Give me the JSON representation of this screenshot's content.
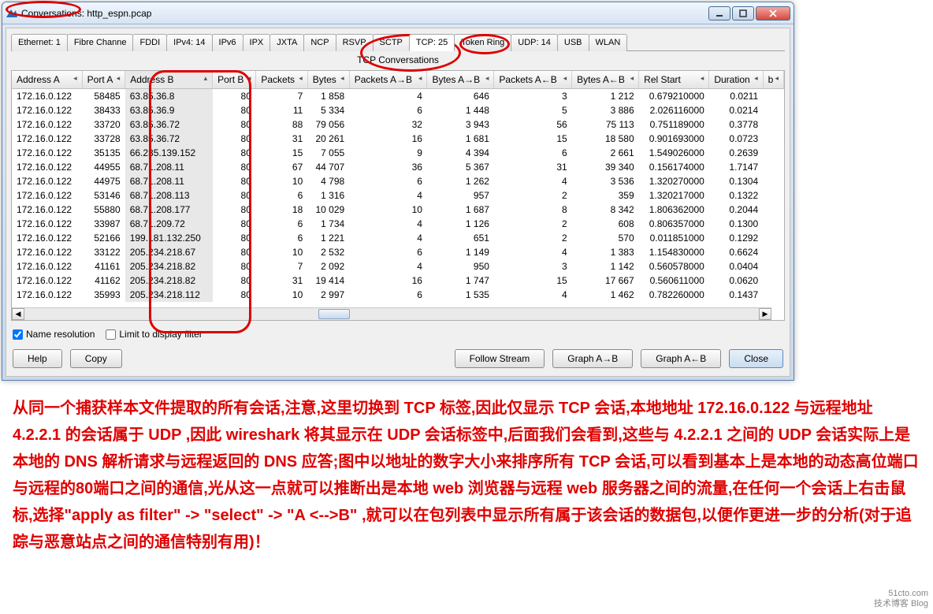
{
  "window": {
    "title": "Conversations: http_espn.pcap",
    "min_icon": "min-icon",
    "max_icon": "max-icon",
    "close_icon": "close-icon"
  },
  "tabs": [
    {
      "label": "Ethernet: 1"
    },
    {
      "label": "Fibre Channe"
    },
    {
      "label": "FDDI"
    },
    {
      "label": "IPv4: 14"
    },
    {
      "label": "IPv6"
    },
    {
      "label": "IPX"
    },
    {
      "label": "JXTA"
    },
    {
      "label": "NCP"
    },
    {
      "label": "RSVP"
    },
    {
      "label": "SCTP"
    },
    {
      "label": "TCP: 25",
      "active": true
    },
    {
      "label": "Token Ring"
    },
    {
      "label": "UDP: 14"
    },
    {
      "label": "USB"
    },
    {
      "label": "WLAN"
    }
  ],
  "subtitle": "TCP Conversations",
  "columns": [
    "Address A",
    "Port A",
    "Address B",
    "Port B",
    "Packets",
    "Bytes",
    "Packets A→B",
    "Bytes A→B",
    "Packets A←B",
    "Bytes A←B",
    "Rel Start",
    "Duration",
    "b"
  ],
  "rows": [
    {
      "aa": "172.16.0.122",
      "pa": "58485",
      "ab": "63.85.36.8",
      "pb": "80",
      "pk": "7",
      "by": "1 858",
      "pab": "4",
      "bab": "646",
      "pba": "3",
      "bba": "1 212",
      "rs": "0.679210000",
      "du": "0.0211"
    },
    {
      "aa": "172.16.0.122",
      "pa": "38433",
      "ab": "63.85.36.9",
      "pb": "80",
      "pk": "11",
      "by": "5 334",
      "pab": "6",
      "bab": "1 448",
      "pba": "5",
      "bba": "3 886",
      "rs": "2.026116000",
      "du": "0.0214"
    },
    {
      "aa": "172.16.0.122",
      "pa": "33720",
      "ab": "63.85.36.72",
      "pb": "80",
      "pk": "88",
      "by": "79 056",
      "pab": "32",
      "bab": "3 943",
      "pba": "56",
      "bba": "75 113",
      "rs": "0.751189000",
      "du": "0.3778"
    },
    {
      "aa": "172.16.0.122",
      "pa": "33728",
      "ab": "63.85.36.72",
      "pb": "80",
      "pk": "31",
      "by": "20 261",
      "pab": "16",
      "bab": "1 681",
      "pba": "15",
      "bba": "18 580",
      "rs": "0.901693000",
      "du": "0.0723"
    },
    {
      "aa": "172.16.0.122",
      "pa": "35135",
      "ab": "66.235.139.152",
      "pb": "80",
      "pk": "15",
      "by": "7 055",
      "pab": "9",
      "bab": "4 394",
      "pba": "6",
      "bba": "2 661",
      "rs": "1.549026000",
      "du": "0.2639"
    },
    {
      "aa": "172.16.0.122",
      "pa": "44955",
      "ab": "68.71.208.11",
      "pb": "80",
      "pk": "67",
      "by": "44 707",
      "pab": "36",
      "bab": "5 367",
      "pba": "31",
      "bba": "39 340",
      "rs": "0.156174000",
      "du": "1.7147"
    },
    {
      "aa": "172.16.0.122",
      "pa": "44975",
      "ab": "68.71.208.11",
      "pb": "80",
      "pk": "10",
      "by": "4 798",
      "pab": "6",
      "bab": "1 262",
      "pba": "4",
      "bba": "3 536",
      "rs": "1.320270000",
      "du": "0.1304"
    },
    {
      "aa": "172.16.0.122",
      "pa": "53146",
      "ab": "68.71.208.113",
      "pb": "80",
      "pk": "6",
      "by": "1 316",
      "pab": "4",
      "bab": "957",
      "pba": "2",
      "bba": "359",
      "rs": "1.320217000",
      "du": "0.1322"
    },
    {
      "aa": "172.16.0.122",
      "pa": "55880",
      "ab": "68.71.208.177",
      "pb": "80",
      "pk": "18",
      "by": "10 029",
      "pab": "10",
      "bab": "1 687",
      "pba": "8",
      "bba": "8 342",
      "rs": "1.806362000",
      "du": "0.2044"
    },
    {
      "aa": "172.16.0.122",
      "pa": "33987",
      "ab": "68.71.209.72",
      "pb": "80",
      "pk": "6",
      "by": "1 734",
      "pab": "4",
      "bab": "1 126",
      "pba": "2",
      "bba": "608",
      "rs": "0.806357000",
      "du": "0.1300"
    },
    {
      "aa": "172.16.0.122",
      "pa": "52166",
      "ab": "199.181.132.250",
      "pb": "80",
      "pk": "6",
      "by": "1 221",
      "pab": "4",
      "bab": "651",
      "pba": "2",
      "bba": "570",
      "rs": "0.011851000",
      "du": "0.1292"
    },
    {
      "aa": "172.16.0.122",
      "pa": "33122",
      "ab": "205.234.218.67",
      "pb": "80",
      "pk": "10",
      "by": "2 532",
      "pab": "6",
      "bab": "1 149",
      "pba": "4",
      "bba": "1 383",
      "rs": "1.154830000",
      "du": "0.6624"
    },
    {
      "aa": "172.16.0.122",
      "pa": "41161",
      "ab": "205.234.218.82",
      "pb": "80",
      "pk": "7",
      "by": "2 092",
      "pab": "4",
      "bab": "950",
      "pba": "3",
      "bba": "1 142",
      "rs": "0.560578000",
      "du": "0.0404"
    },
    {
      "aa": "172.16.0.122",
      "pa": "41162",
      "ab": "205.234.218.82",
      "pb": "80",
      "pk": "31",
      "by": "19 414",
      "pab": "16",
      "bab": "1 747",
      "pba": "15",
      "bba": "17 667",
      "rs": "0.560611000",
      "du": "0.0620"
    },
    {
      "aa": "172.16.0.122",
      "pa": "35993",
      "ab": "205.234.218.112",
      "pb": "80",
      "pk": "10",
      "by": "2 997",
      "pab": "6",
      "bab": "1 535",
      "pba": "4",
      "bba": "1 462",
      "rs": "0.782260000",
      "du": "0.1437"
    }
  ],
  "options": {
    "name_resolution": "Name resolution",
    "limit_filter": "Limit to display filter"
  },
  "buttons": {
    "help": "Help",
    "copy": "Copy",
    "follow": "Follow Stream",
    "graph_ab": "Graph A→B",
    "graph_ba": "Graph A←B",
    "close": "Close"
  },
  "commentary": "从同一个捕获样本文件提取的所有会话,注意,这里切换到 TCP 标签,因此仅显示 TCP 会话,本地地址 172.16.0.122 与远程地址 4.2.2.1 的会话属于 UDP ,因此 wireshark 将其显示在 UDP 会话标签中,后面我们会看到,这些与 4.2.2.1 之间的 UDP 会话实际上是本地的 DNS 解析请求与远程返回的 DNS 应答;图中以地址的数字大小来排序所有 TCP 会话,可以看到基本上是本地的动态高位端口与远程的80端口之间的通信,光从这一点就可以推断出是本地 web 浏览器与远程 web 服务器之间的流量,在任何一个会话上右击鼠标,选择\"apply as filter\" -> \"select\" -> \"A <-->B\" ,就可以在包列表中显示所有属于该会话的数据包,以便作更进一步的分析(对于追踪与恶意站点之间的通信特别有用)！",
  "watermark": {
    "l1": "51cto.com",
    "l2": "技术博客  Blog"
  }
}
